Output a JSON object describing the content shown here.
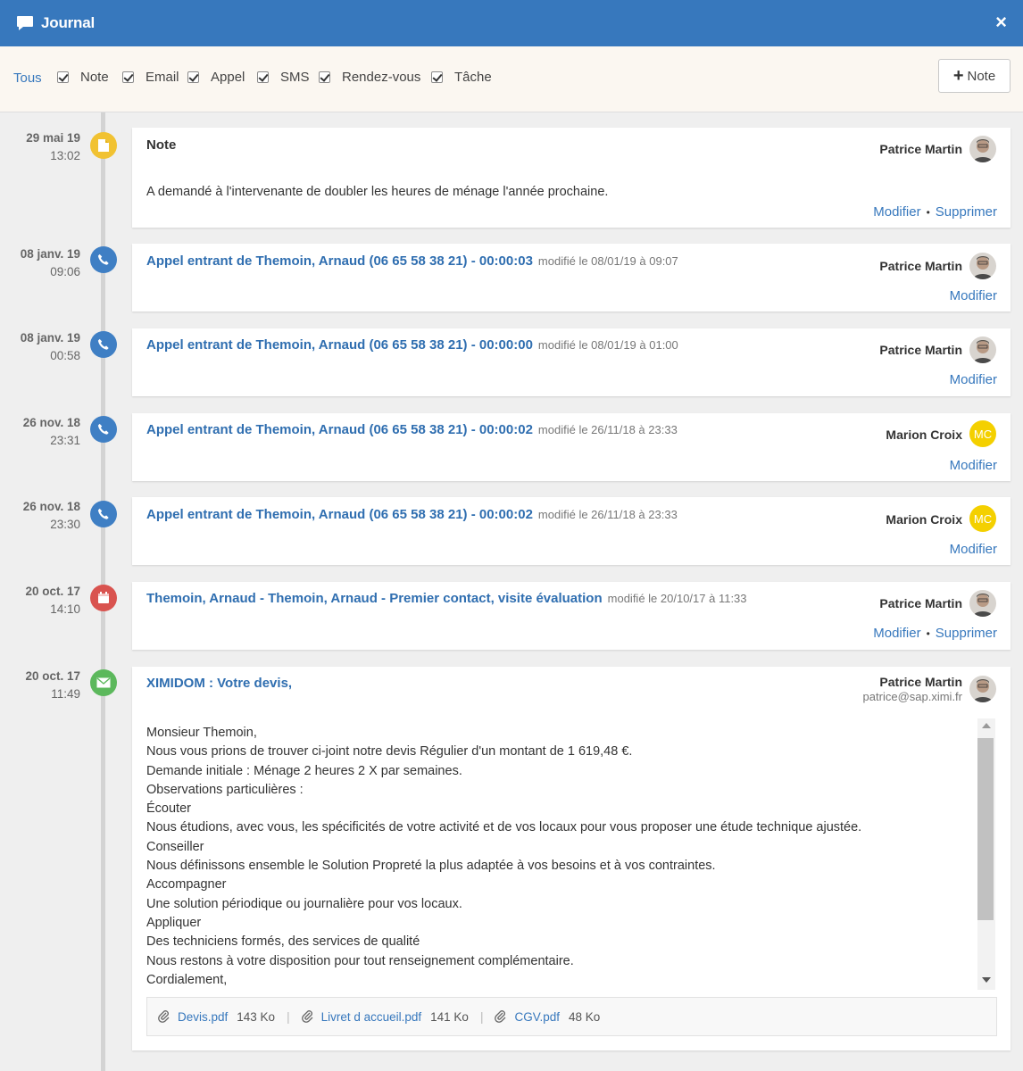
{
  "window": {
    "title": "Journal",
    "close_label": "×"
  },
  "filters": {
    "all_label": "Tous",
    "items": [
      {
        "label": "Note",
        "checked": true
      },
      {
        "label": "Email",
        "checked": true
      },
      {
        "label": "Appel",
        "checked": true
      },
      {
        "label": "SMS",
        "checked": true
      },
      {
        "label": "Rendez-vous",
        "checked": true
      },
      {
        "label": "Tâche",
        "checked": true
      }
    ],
    "add_note_label": "Note"
  },
  "entries": [
    {
      "type": "note",
      "date": "29 mai 19",
      "time": "13:02",
      "title": "Note",
      "user": "Patrice Martin",
      "body": "A demandé à l'intervenante de doubler les heures de ménage l'année prochaine.",
      "edit": "Modifier",
      "delete": "Supprimer"
    },
    {
      "type": "call",
      "date": "08 janv. 19",
      "time": "09:06",
      "title": "Appel entrant de Themoin, Arnaud (06 65 58 38 21) - 00:00:03",
      "modified": "modifié le 08/01/19 à 09:07",
      "user": "Patrice Martin",
      "edit": "Modifier"
    },
    {
      "type": "call",
      "date": "08 janv. 19",
      "time": "00:58",
      "title": "Appel entrant de Themoin, Arnaud (06 65 58 38 21) - 00:00:00",
      "modified": "modifié le 08/01/19 à 01:00",
      "user": "Patrice Martin",
      "edit": "Modifier"
    },
    {
      "type": "call",
      "date": "26 nov. 18",
      "time": "23:31",
      "title": "Appel entrant de Themoin, Arnaud (06 65 58 38 21) - 00:00:02",
      "modified": "modifié le 26/11/18 à 23:33",
      "user": "Marion Croix",
      "initials": "MC",
      "edit": "Modifier"
    },
    {
      "type": "call",
      "date": "26 nov. 18",
      "time": "23:30",
      "title": "Appel entrant de Themoin, Arnaud (06 65 58 38 21) - 00:00:02",
      "modified": "modifié le 26/11/18 à 23:33",
      "user": "Marion Croix",
      "initials": "MC",
      "edit": "Modifier"
    },
    {
      "type": "rdv",
      "date": "20 oct. 17",
      "time": "14:10",
      "title": "Themoin, Arnaud - Themoin, Arnaud - Premier contact, visite évaluation",
      "modified": "modifié le 20/10/17 à 11:33",
      "user": "Patrice Martin",
      "edit": "Modifier",
      "delete": "Supprimer"
    },
    {
      "type": "email",
      "date": "20 oct. 17",
      "time": "11:49",
      "title": "XIMIDOM : Votre devis,",
      "user": "Patrice Martin",
      "user_email": "patrice@sap.ximi.fr",
      "lines": [
        "Monsieur Themoin,",
        "Nous vous prions de trouver ci-joint notre devis Régulier d'un montant de 1 619,48 €.",
        "Demande initiale : Ménage 2 heures 2 X par semaines.",
        "Observations particulières :",
        "Écouter",
        "Nous étudions, avec vous, les spécificités de votre activité et de vos locaux pour vous proposer une étude technique ajustée.",
        "Conseiller",
        "Nous définissons ensemble le Solution Propreté la plus adaptée à vos besoins et à vos contraintes.",
        "Accompagner",
        "Une solution périodique ou journalière pour vos locaux.",
        "Appliquer",
        "Des techniciens formés, des services de qualité",
        "Nous restons à votre disposition pour tout renseignement complémentaire.",
        "Cordialement,"
      ],
      "attachments": [
        {
          "name": "Devis.pdf",
          "size": "143 Ko"
        },
        {
          "name": "Livret d accueil.pdf",
          "size": "141 Ko"
        },
        {
          "name": "CGV.pdf",
          "size": "48 Ko"
        }
      ]
    }
  ]
}
